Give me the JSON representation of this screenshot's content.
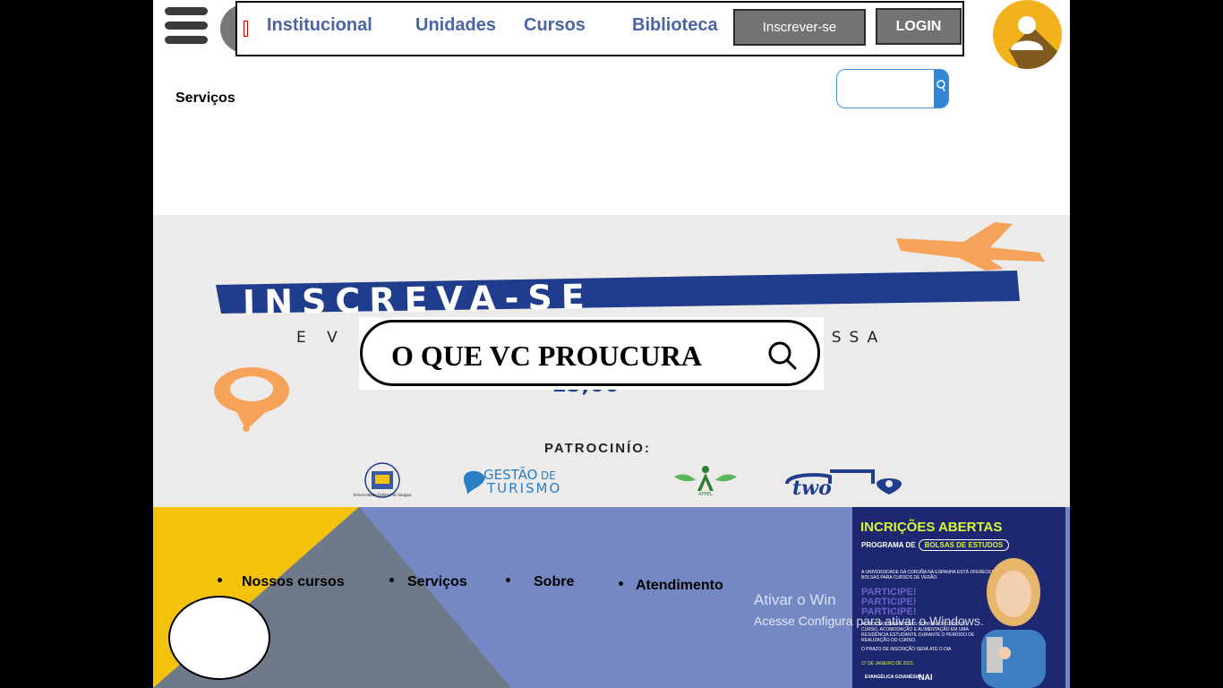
{
  "nav": {
    "links": [
      "Institucional",
      "Unidades",
      "Cursos",
      "Biblioteca"
    ],
    "signup_label": "Inscrever-se",
    "login_label": "LOGIN"
  },
  "header": {
    "services_label": "Serviços",
    "search_placeholder": ""
  },
  "banner": {
    "headline": "INSCREVA-SE",
    "subtitle_left": "E V",
    "subtitle_right": "ESSA",
    "partial_text": "15,00",
    "sponsors_label": "PATROCINÍO:",
    "sponsor_logos": [
      "Universidade Federal de Sergipe",
      "Gestão de Turismo",
      "APPEL",
      "TWO"
    ],
    "search_prompt": "O QUE VC PROUCURA"
  },
  "footer": {
    "links": [
      "Nossos cursos",
      "Serviços",
      "Sobre",
      "Atendimento"
    ]
  },
  "poster": {
    "title": "INCRIÇÕES ABERTAS",
    "program_prefix": "PROGRAMA DE",
    "program_highlight": "BOLSAS DE ESTUDOS",
    "body1": "A UNIVERSIDADE DA CORUÑA NA ESPANHA ESTÁ OFERECENDO BOLSAS PARA CURSOS DE VERÃO.",
    "cta": "PARTICIPE! PARTICIPE! PARTICIPE!",
    "body2": "AS BOLSAS OFERECIDAS COBREM O CUSTO DO CURSO, ACOMODAÇÃO E ALIMENTAÇÃO EM UMA RESIDÊNCIA ESTUDANTIL DURANTE O PERÍODO DE REALIZAÇÃO DO CURSO.",
    "body3": "O PRAZO DE INSCRIÇÃO SERÁ ATÉ O DIA",
    "deadline": "27 DE JANEIRO DE 2021.",
    "footer_left": "EVANGÉLICA GOIANÉSIA",
    "footer_right": "NAI"
  },
  "watermark": {
    "line1": "Ativar o Win",
    "line2": "Acesse Configura      para ativar o Windows."
  },
  "colors": {
    "nav_link": "#4a64a6",
    "button_gray": "#737373",
    "avatar_orange": "#f2b21c",
    "footer_blue": "#7488c3",
    "footer_yellow": "#f4c20d",
    "footer_gray": "#6e7a8a",
    "poster_navy": "#1d2870",
    "poster_lime": "#d9f33a",
    "banner_blue": "#1f3d8c",
    "banner_orange": "#f5a35a"
  },
  "icons": [
    "hamburger-icon",
    "user-icon",
    "search-icon",
    "airplane-icon",
    "location-pin-icon"
  ]
}
